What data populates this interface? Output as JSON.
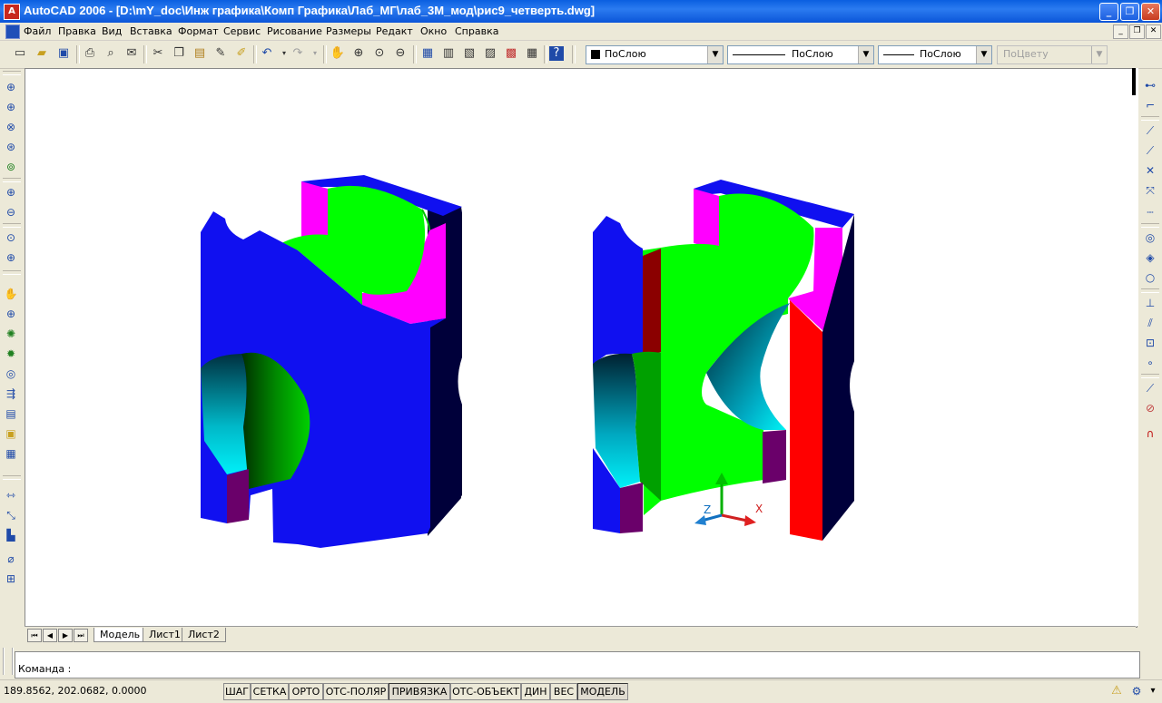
{
  "window": {
    "title": "AutoCAD 2006 - [D:\\mY_doc\\Инж графика\\Комп Графика\\Лаб_МГ\\лаб_3М_мод\\рис9_четверть.dwg]",
    "app_icon": "autocad-logo-icon",
    "minimize": "_",
    "maximize": "❐",
    "close": "✕"
  },
  "menu": {
    "items": [
      "Файл",
      "Правка",
      "Вид",
      "Вставка",
      "Формат",
      "Сервис",
      "Рисование",
      "Размеры",
      "Редакт",
      "Окно",
      "Справка"
    ],
    "doc_minimize": "_",
    "doc_restore": "❐",
    "doc_close": "✕"
  },
  "toolbar": {
    "color_combo": "ПоСлою",
    "linetype_combo": "ПоСлою",
    "lineweight_combo": "ПоСлою",
    "plotstyle_combo": "ПоЦвету"
  },
  "layout_tabs": [
    "Модель",
    "Лист1",
    "Лист2"
  ],
  "command": {
    "label": "Команда :"
  },
  "status": {
    "coords": "189.8562,  202.0682, 0.0000",
    "buttons": [
      {
        "label": "ШАГ",
        "on": false
      },
      {
        "label": "СЕТКА",
        "on": false
      },
      {
        "label": "ОРТО",
        "on": false
      },
      {
        "label": "ОТС-ПОЛЯР",
        "on": false
      },
      {
        "label": "ПРИВЯЗКА",
        "on": true
      },
      {
        "label": "ОТС-ОБЪЕКТ",
        "on": false
      },
      {
        "label": "ДИН",
        "on": false
      },
      {
        "label": "ВЕС",
        "on": false
      },
      {
        "label": "МОДЕЛЬ",
        "on": true
      }
    ]
  },
  "ucs": {
    "z_label": "Z",
    "x_label": "X"
  },
  "colors": {
    "blue": "#1010f0",
    "dark_navy": "#00003a",
    "green": "#00ff00",
    "magenta": "#ff00ff",
    "red": "#ff0000",
    "dark_red": "#8b0000",
    "purple": "#6a006a",
    "cyan": "#00d0e0"
  }
}
